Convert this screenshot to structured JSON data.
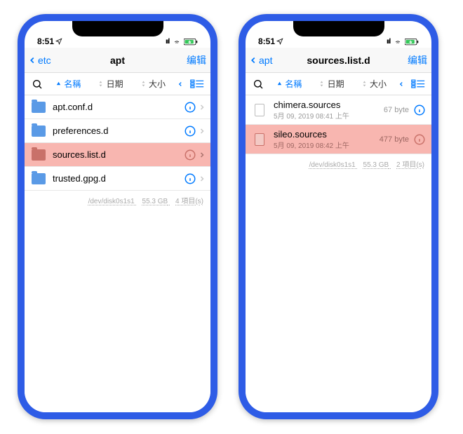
{
  "status": {
    "time": "8:51",
    "signal": "••ıl",
    "wifi": true,
    "battery": true
  },
  "phone1": {
    "back": "etc",
    "title": "apt",
    "edit": "编辑",
    "sort": {
      "name": "名稱",
      "date": "日期",
      "size": "大小"
    },
    "rows": [
      {
        "name": "apt.conf.d",
        "type": "folder"
      },
      {
        "name": "preferences.d",
        "type": "folder"
      },
      {
        "name": "sources.list.d",
        "type": "folder",
        "hl": true
      },
      {
        "name": "trusted.gpg.d",
        "type": "folder"
      }
    ],
    "footer": {
      "disk": "/dev/disk0s1s1",
      "size": "55.3 GB",
      "count": "4 項目(s)"
    }
  },
  "phone2": {
    "back": "apt",
    "title": "sources.list.d",
    "edit": "编辑",
    "sort": {
      "name": "名稱",
      "date": "日期",
      "size": "大小"
    },
    "rows": [
      {
        "name": "chimera.sources",
        "date": "5月 09, 2019 08:41 上午",
        "bytes": "67 byte",
        "type": "file"
      },
      {
        "name": "sileo.sources",
        "date": "5月 09, 2019 08:42 上午",
        "bytes": "477 byte",
        "type": "file",
        "hl": true
      }
    ],
    "footer": {
      "disk": "/dev/disk0s1s1",
      "size": "55.3 GB",
      "count": "2 項目(s)"
    }
  }
}
